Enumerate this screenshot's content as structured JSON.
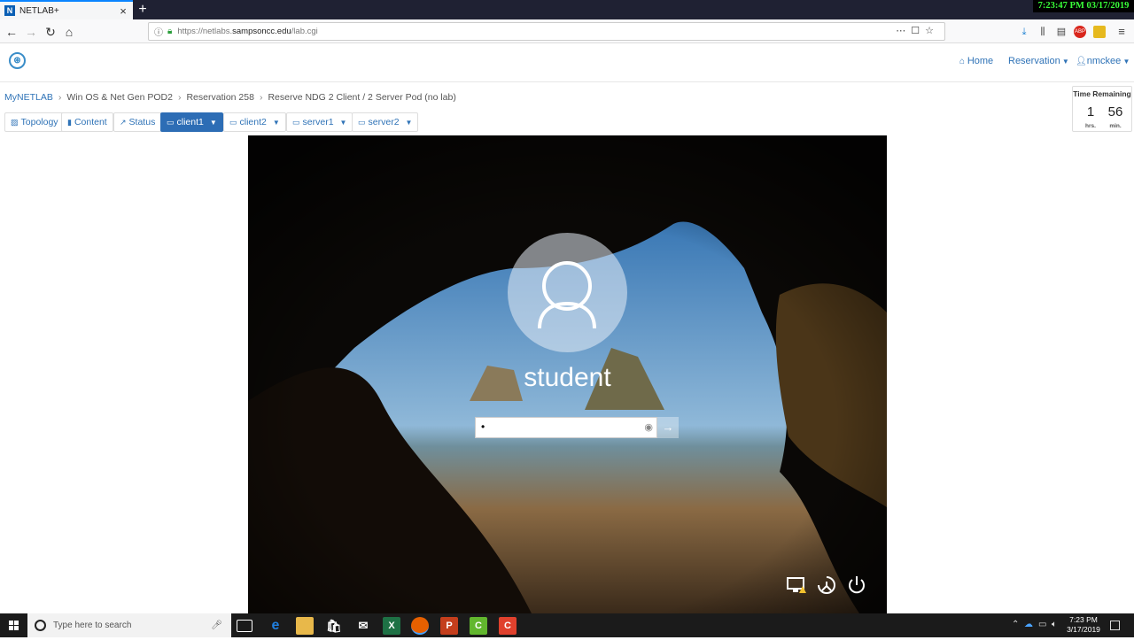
{
  "browser": {
    "tab_title": "NETLAB+",
    "tab_favicon": "N",
    "tab_close": "×",
    "new_tab": "+",
    "overlay_clock": "7:23:47 PM 03/17/2019",
    "url_prefix": "https://netlabs.",
    "url_host": "sampsoncc.edu",
    "url_path": "/lab.cgi"
  },
  "header": {
    "home": "Home",
    "reservation": "Reservation",
    "user": "nmckee"
  },
  "breadcrumb": [
    "MyNETLAB",
    "Win OS & Net Gen POD2",
    "Reservation 258",
    "Reserve NDG 2 Client / 2 Server Pod (no lab)"
  ],
  "toolbar": {
    "topology": "Topology",
    "content": "Content",
    "status": "Status",
    "client1": "client1",
    "client2": "client2",
    "server1": "server1",
    "server2": "server2"
  },
  "time_remaining": {
    "title": "Time Remaining",
    "hours": "1",
    "hours_unit": "hrs.",
    "minutes": "56",
    "minutes_unit": "min."
  },
  "lockscreen": {
    "username": "student",
    "password_value": "•"
  },
  "taskbar": {
    "search_placeholder": "Type here to search",
    "time": "7:23 PM",
    "date": "3/17/2019"
  },
  "colors": {
    "accent": "#2d6db5",
    "link": "#2f73b7",
    "overlay_clock": "#39ff39"
  }
}
